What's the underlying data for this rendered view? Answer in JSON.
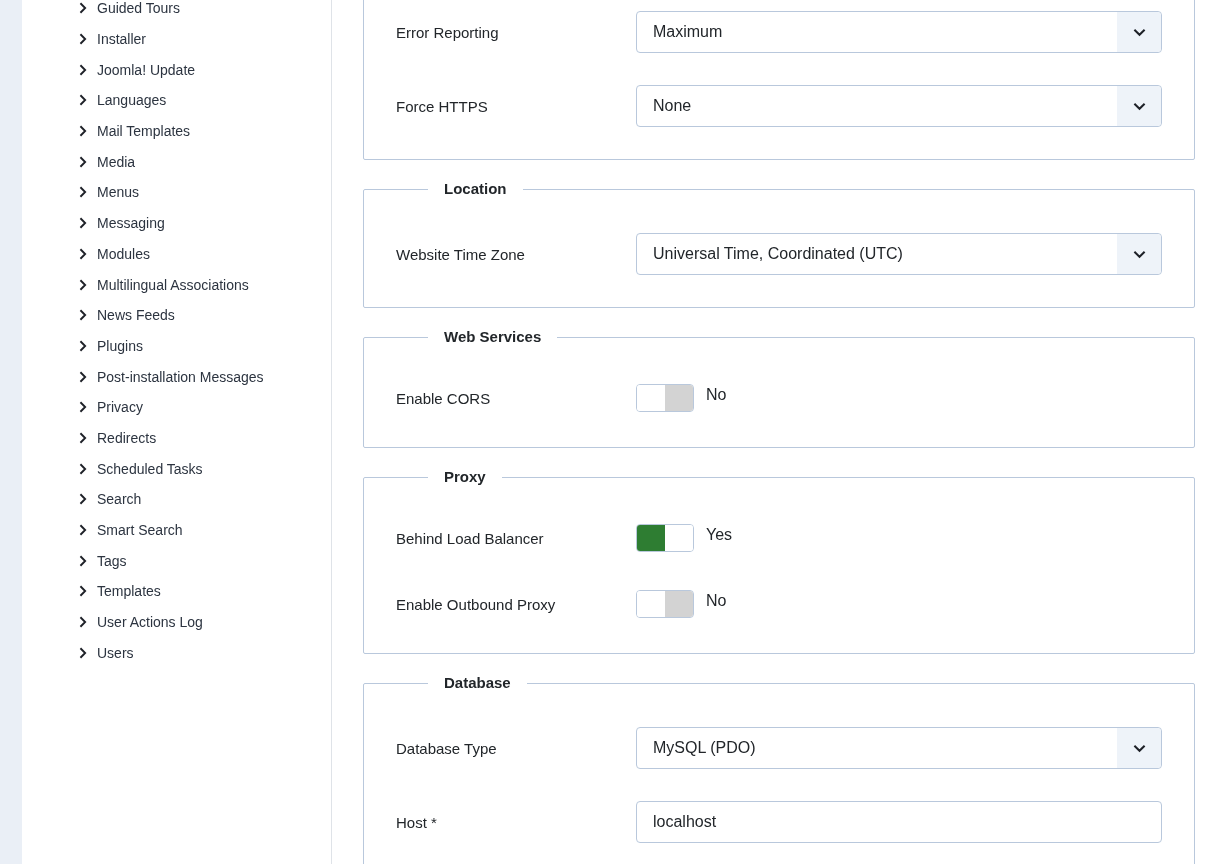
{
  "sidebar": {
    "items": [
      {
        "label": "Guided Tours"
      },
      {
        "label": "Installer"
      },
      {
        "label": "Joomla! Update"
      },
      {
        "label": "Languages"
      },
      {
        "label": "Mail Templates"
      },
      {
        "label": "Media"
      },
      {
        "label": "Menus"
      },
      {
        "label": "Messaging"
      },
      {
        "label": "Modules"
      },
      {
        "label": "Multilingual Associations"
      },
      {
        "label": "News Feeds"
      },
      {
        "label": "Plugins"
      },
      {
        "label": "Post-installation Messages"
      },
      {
        "label": "Privacy"
      },
      {
        "label": "Redirects"
      },
      {
        "label": "Scheduled Tasks"
      },
      {
        "label": "Search"
      },
      {
        "label": "Smart Search"
      },
      {
        "label": "Tags"
      },
      {
        "label": "Templates"
      },
      {
        "label": "User Actions Log"
      },
      {
        "label": "Users"
      }
    ]
  },
  "sections": [
    {
      "fields": [
        {
          "kind": "select",
          "label": "Error Reporting",
          "value": "Maximum"
        },
        {
          "kind": "select",
          "label": "Force HTTPS",
          "value": "None"
        }
      ]
    },
    {
      "legend": "Location",
      "fields": [
        {
          "kind": "select",
          "label": "Website Time Zone",
          "value": "Universal Time, Coordinated (UTC)"
        }
      ]
    },
    {
      "legend": "Web Services",
      "fields": [
        {
          "kind": "toggle",
          "label": "Enable CORS",
          "on": false,
          "state_text": "No"
        }
      ]
    },
    {
      "legend": "Proxy",
      "fields": [
        {
          "kind": "toggle",
          "label": "Behind Load Balancer",
          "on": true,
          "state_text": "Yes"
        },
        {
          "kind": "toggle",
          "label": "Enable Outbound Proxy",
          "on": false,
          "state_text": "No"
        }
      ]
    },
    {
      "legend": "Database",
      "fields": [
        {
          "kind": "select",
          "label": "Database Type",
          "value": "MySQL (PDO)"
        },
        {
          "kind": "text",
          "label": "Host *",
          "value": "localhost"
        }
      ]
    }
  ]
}
